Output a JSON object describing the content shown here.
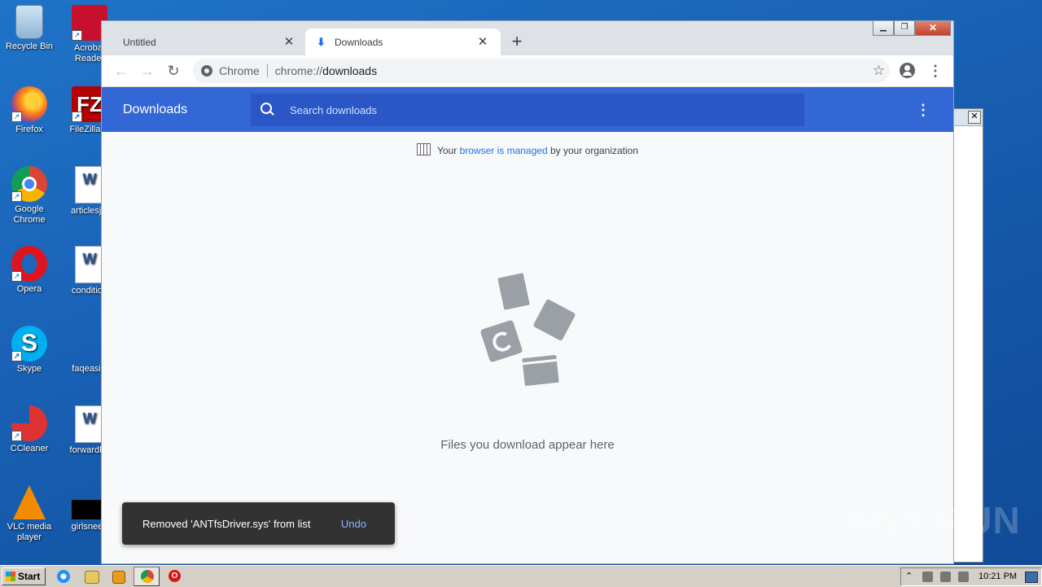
{
  "desktop": {
    "icons_left": [
      {
        "label": "Recycle Bin"
      },
      {
        "label": "Firefox"
      },
      {
        "label": "Google Chrome"
      },
      {
        "label": "Opera"
      },
      {
        "label": "Skype"
      },
      {
        "label": "CCleaner"
      },
      {
        "label": "VLC media player"
      }
    ],
    "icons_right": [
      {
        "label": "Acrobat Reader"
      },
      {
        "label": "FileZilla C"
      },
      {
        "label": "articlesjoi"
      },
      {
        "label": "condition"
      },
      {
        "label": "faqeasily"
      },
      {
        "label": "forwardhe"
      },
      {
        "label": "girlsneed"
      }
    ]
  },
  "browser": {
    "tabs": [
      {
        "title": "Untitled",
        "active": false
      },
      {
        "title": "Downloads",
        "active": true
      }
    ],
    "omnibox": {
      "scheme_label": "Chrome",
      "url_prefix": "chrome://",
      "url_host": "downloads"
    }
  },
  "downloads_page": {
    "heading": "Downloads",
    "search_placeholder": "Search downloads",
    "managed": {
      "prefix": "Your ",
      "link": "browser is managed",
      "suffix": " by your organization"
    },
    "empty_message": "Files you download appear here"
  },
  "toast": {
    "message": "Removed 'ANTfsDriver.sys' from list",
    "action": "Undo"
  },
  "watermark": "ANY RUN",
  "taskbar": {
    "start_label": "Start",
    "clock": "10:21 PM"
  },
  "colors": {
    "header_blue": "#3367d6",
    "search_blue": "#2a56c6",
    "link_blue": "#1a73e8",
    "toast_bg": "#323232",
    "undo": "#8ab4f8"
  }
}
